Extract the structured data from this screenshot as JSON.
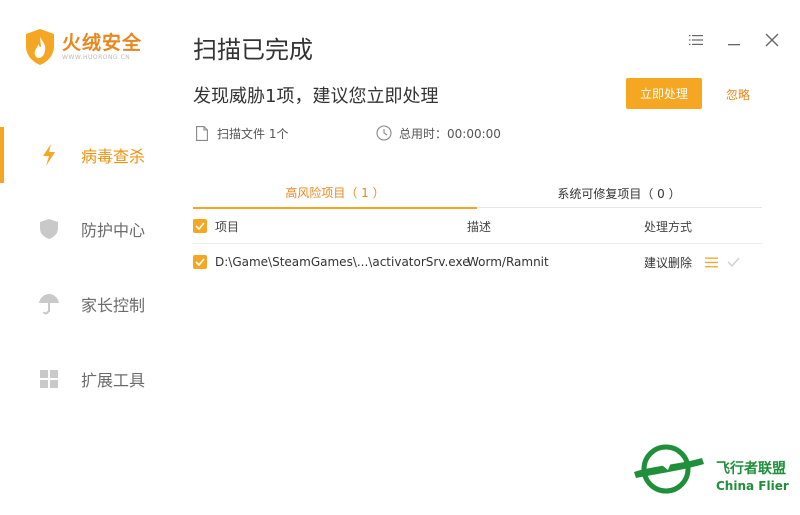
{
  "app": {
    "name": "火绒安全",
    "url": "WWW.HUORONG.CN"
  },
  "sidebar": {
    "items": [
      {
        "label": "病毒查杀",
        "icon": "lightning-icon",
        "active": true
      },
      {
        "label": "防护中心",
        "icon": "shield-icon",
        "active": false
      },
      {
        "label": "家长控制",
        "icon": "umbrella-icon",
        "active": false
      },
      {
        "label": "扩展工具",
        "icon": "grid-icon",
        "active": false
      }
    ]
  },
  "header": {
    "title": "扫描已完成",
    "subtitle": "发现威胁1项，建议您立即处理",
    "primary_button": "立即处理",
    "ignore_link": "忽略"
  },
  "meta": {
    "files_label": "扫描文件 1个",
    "time_label": "总用时：00:00:00"
  },
  "tabs": [
    {
      "label": "高风险项目（ 1 ）",
      "active": true
    },
    {
      "label": "系统可修复项目（ 0 ）",
      "active": false
    }
  ],
  "table": {
    "columns": [
      "项目",
      "描述",
      "处理方式"
    ],
    "rows": [
      {
        "item": "D:\\Game\\SteamGames\\...\\activatorSrv.exe",
        "description": "Worm/Ramnit",
        "action": "建议删除",
        "checked": true
      }
    ]
  },
  "watermark": {
    "cn": "飞行者联盟",
    "en": "China Flier"
  },
  "colors": {
    "accent": "#f5a623",
    "accent_text": "#e8871e",
    "watermark_green": "#1f8f3a"
  }
}
